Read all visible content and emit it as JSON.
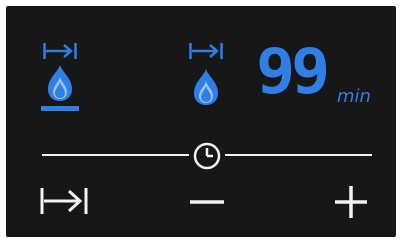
{
  "colors": {
    "panel_background": "#171717",
    "accent_blue": "#2f7fe6",
    "foreground_white": "#f2f2f2"
  },
  "burners": [
    {
      "icon": "flame-icon",
      "boost_icon": "boost-arrow-icon",
      "underlined": true
    },
    {
      "icon": "flame-icon",
      "boost_icon": "boost-arrow-icon",
      "underlined": false
    }
  ],
  "timer": {
    "value": "99",
    "unit": "min",
    "icon": "clock-icon"
  },
  "controls": {
    "boost_button_icon": "boost-arrow-icon",
    "minus_button_icon": "minus-icon",
    "plus_button_icon": "plus-icon"
  }
}
